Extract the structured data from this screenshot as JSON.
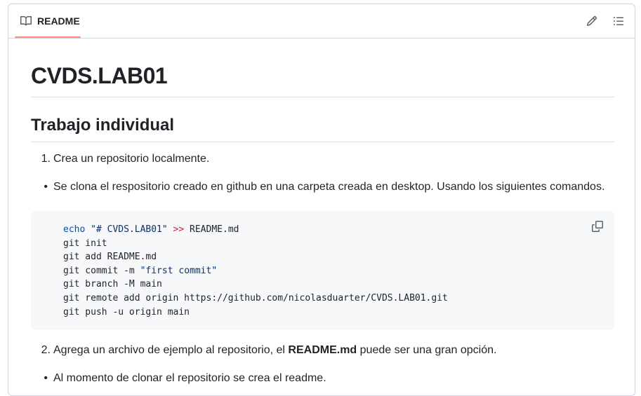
{
  "header": {
    "tab_label": "README",
    "tab_icon": "book-icon",
    "edit_icon": "pencil-icon",
    "outline_icon": "list-icon",
    "accent_color": "#fd8c73"
  },
  "readme": {
    "title": "CVDS.LAB01",
    "section_heading": "Trabajo individual",
    "step1": {
      "marker": "1.",
      "text": "Crea un repositorio localmente."
    },
    "bullet1": "Se clona el respositorio creado en github en una carpeta creada en desktop. Usando los siguientes comandos.",
    "code": {
      "line1_cmd": "echo",
      "line1_str": "\"# CVDS.LAB01\"",
      "line1_op": ">>",
      "line1_rest": "README.md",
      "line2": "git init",
      "line3": "git add README.md",
      "line4_pre": "git commit -m ",
      "line4_str": "\"first commit\"",
      "line5": "git branch -M main",
      "line6": "git remote add origin https://github.com/nicolasduarter/CVDS.LAB01.git",
      "line7": "git push -u origin main",
      "copy_icon": "copy-icon"
    },
    "step2": {
      "marker": "2.",
      "text_before": "Agrega un archivo de ejemplo al repositorio, el ",
      "bold": "README.md",
      "text_after": " puede ser una gran opción."
    },
    "bullet2": "Al momento de clonar el repositorio se crea el readme."
  }
}
